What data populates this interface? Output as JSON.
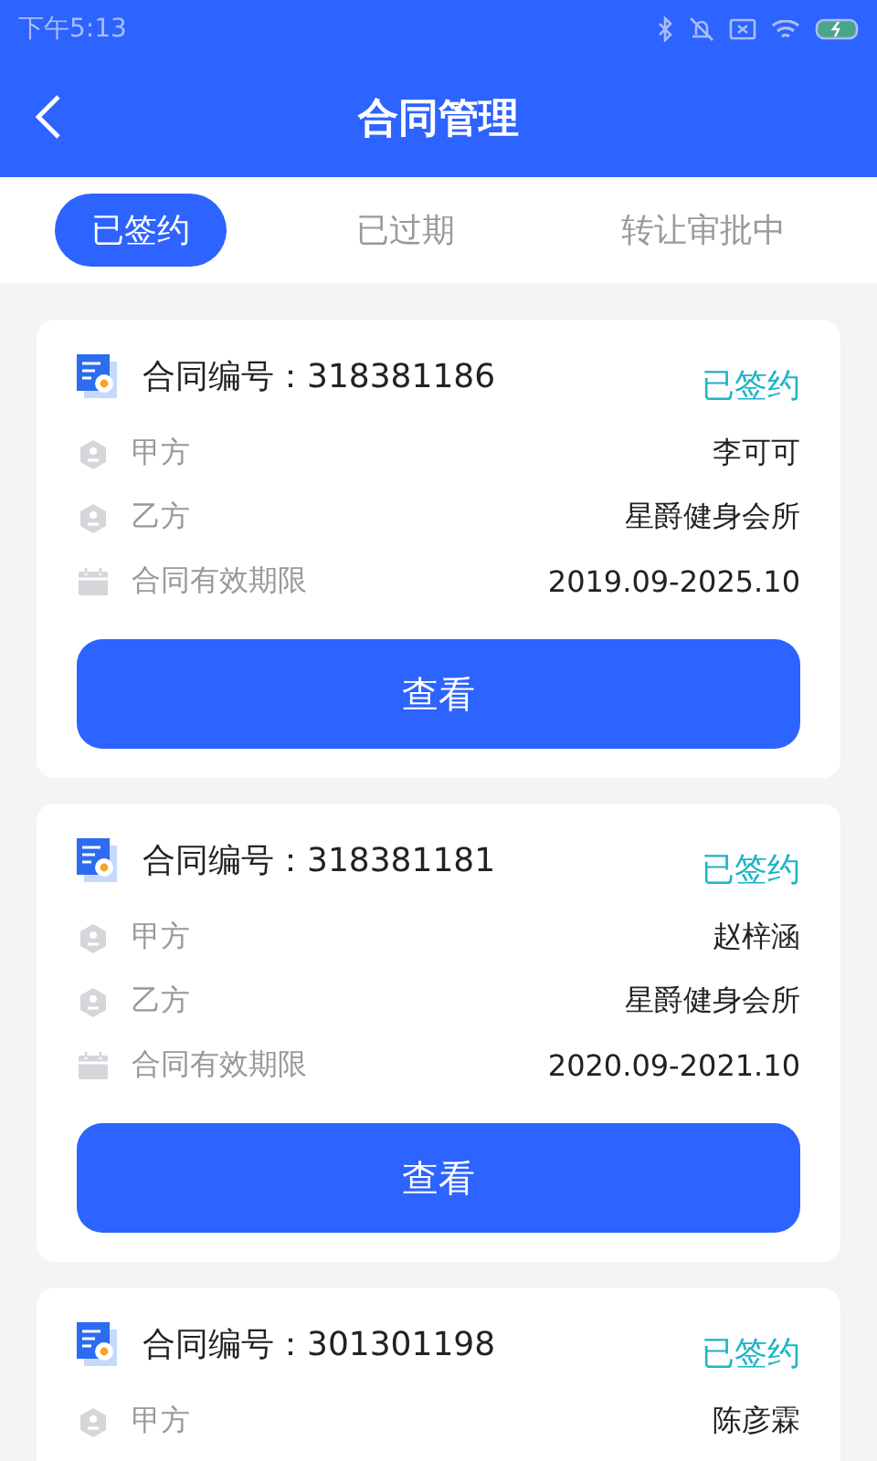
{
  "status_bar": {
    "time": "下午5:13"
  },
  "header": {
    "title": "合同管理"
  },
  "tabs": [
    {
      "label": "已签约",
      "selected": true
    },
    {
      "label": "已过期",
      "selected": false
    },
    {
      "label": "转让审批中",
      "selected": false
    }
  ],
  "contracts": [
    {
      "number": "合同编号：318381186",
      "status": "已签约",
      "rows": [
        {
          "kind": "party",
          "label": "甲方",
          "value": "李可可"
        },
        {
          "kind": "party",
          "label": "乙方",
          "value": "星爵健身会所"
        },
        {
          "kind": "period",
          "label": "合同有效期限",
          "value": "2019.09-2025.10"
        }
      ],
      "button": "查看"
    },
    {
      "number": "合同编号：318381181",
      "status": "已签约",
      "rows": [
        {
          "kind": "party",
          "label": "甲方",
          "value": "赵梓涵"
        },
        {
          "kind": "party",
          "label": "乙方",
          "value": "星爵健身会所"
        },
        {
          "kind": "period",
          "label": "合同有效期限",
          "value": "2020.09-2021.10"
        }
      ],
      "button": "查看"
    },
    {
      "number": "合同编号：301301198",
      "status": "已签约",
      "rows": [
        {
          "kind": "party",
          "label": "甲方",
          "value": "陈彦霖"
        }
      ]
    }
  ]
}
